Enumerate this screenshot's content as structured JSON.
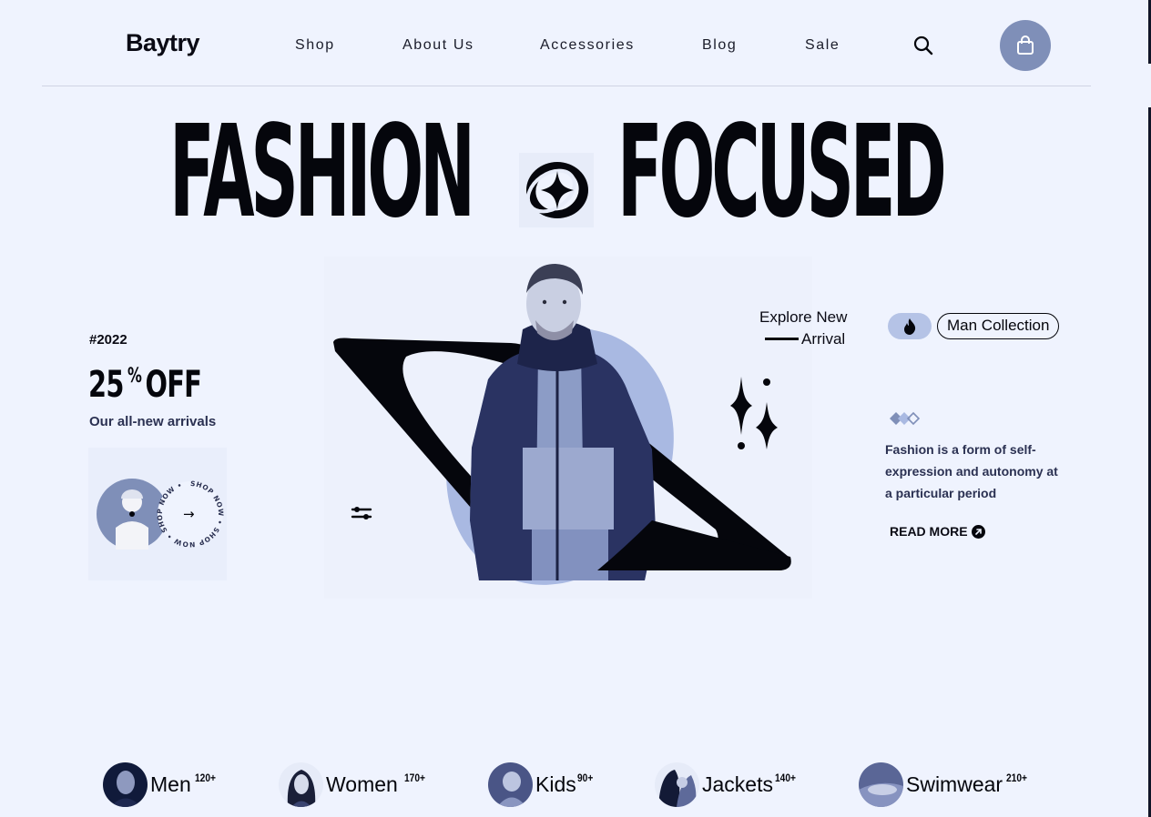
{
  "brand": "Baytry",
  "nav": {
    "items": [
      "Shop",
      "About Us",
      "Accessories",
      "Blog",
      "Sale"
    ],
    "search_icon": "search-icon",
    "cart_icon": "shopping-bag-icon"
  },
  "hero": {
    "headline_left": "FASHION",
    "headline_right": "FOCUSED",
    "badge_icon": "four-point-star-icon"
  },
  "promo": {
    "year_tag": "#2022",
    "discount_number": "25",
    "discount_percent": "%",
    "discount_off": "OFF",
    "subtitle": "Our all-new arrivals",
    "shop_now_ring": "SHOP NOW • SHOP NOW • SHOP NOW •",
    "arrow": "→"
  },
  "explore": {
    "line1": "Explore New",
    "line2": "Arrival"
  },
  "collection": {
    "fire_icon": "flame-icon",
    "label": "Man Collection",
    "description": "Fashion is a form of self-expression and autonomy at a particular period",
    "read_more": "READ MORE",
    "read_more_icon": "arrow-up-right-circle-icon"
  },
  "categories": [
    {
      "name": "Men",
      "count": "120+"
    },
    {
      "name": "Women",
      "count": "170+"
    },
    {
      "name": "Kids",
      "count": "90+"
    },
    {
      "name": "Jackets",
      "count": "140+"
    },
    {
      "name": "Swimwear",
      "count": "210+"
    }
  ],
  "colors": {
    "background": "#eff3fe",
    "accent": "#7f8fb8",
    "accent_light": "#b5c3e6",
    "ink": "#05060c"
  }
}
